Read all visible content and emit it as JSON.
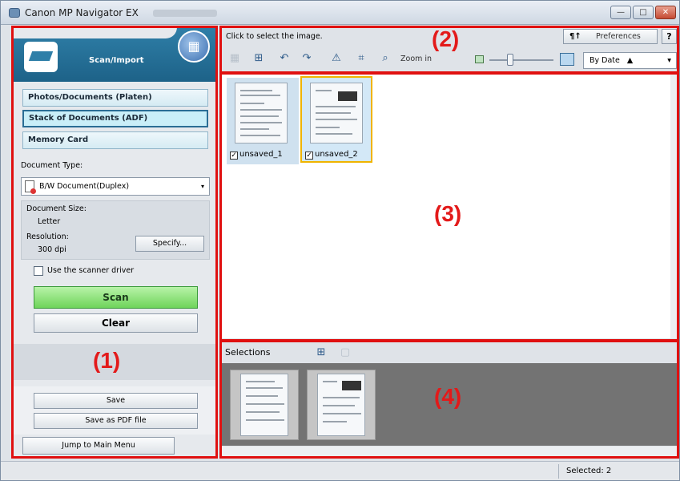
{
  "window": {
    "title": "Canon MP Navigator EX",
    "buttons": {
      "minimize": "—",
      "maximize": "□",
      "close": "✕"
    }
  },
  "left_panel": {
    "mode_label": "Scan/Import",
    "sources": [
      {
        "label": "Photos/Documents (Platen)",
        "active": false
      },
      {
        "label": "Stack of Documents (ADF)",
        "active": true
      },
      {
        "label": "Memory Card",
        "active": false
      }
    ],
    "document_type_label": "Document Type:",
    "document_type_value": "B/W Document(Duplex)",
    "document_size_label": "Document Size:",
    "document_size_value": "Letter",
    "resolution_label": "Resolution:",
    "resolution_value": "300 dpi",
    "specify_label": "Specify...",
    "use_scanner_driver_label": "Use the scanner driver",
    "use_scanner_driver_checked": false,
    "scan_label": "Scan",
    "clear_label": "Clear",
    "save_label": "Save",
    "save_pdf_label": "Save as PDF file",
    "jump_label": "Jump to Main Menu"
  },
  "toolbar": {
    "hint": "Click to select the image.",
    "preferences_label": "Preferences",
    "help_label": "?",
    "zoom_label": "Zoom in",
    "sort_value": "By Date",
    "sort_arrow": "▲",
    "dropdown_arrow": "▾"
  },
  "thumbnails": [
    {
      "name": "unsaved_1",
      "checked": true,
      "highlighted": false
    },
    {
      "name": "unsaved_2",
      "checked": true,
      "highlighted": true
    }
  ],
  "selections": {
    "title": "Selections",
    "count": 2
  },
  "status": {
    "selected_text": "Selected: 2"
  },
  "region_labels": {
    "r1": "(1)",
    "r2": "(2)",
    "r3": "(3)",
    "r4": "(4)"
  },
  "colors": {
    "accent_red": "#e01010",
    "scan_green": "#6fd45b",
    "header_blue": "#1d6288",
    "selection_yellow": "#f0b400"
  }
}
